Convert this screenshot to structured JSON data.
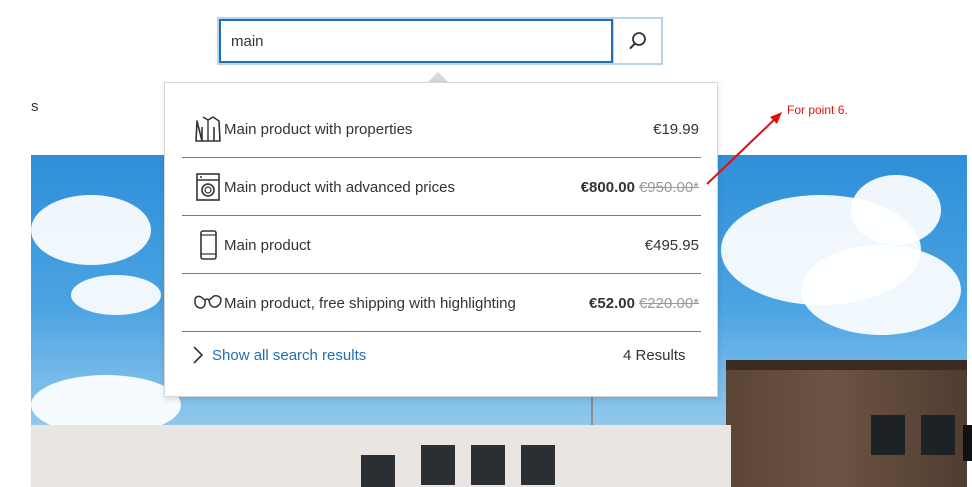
{
  "search": {
    "value": "main",
    "button_icon": "search-icon"
  },
  "page": {
    "left_label": "s"
  },
  "results": [
    {
      "icon": "jacket-icon",
      "name": "Main product with properties",
      "price": "€19.99",
      "old_price": ""
    },
    {
      "icon": "washing-machine-icon",
      "name": "Main product with advanced prices",
      "price": "€800.00",
      "old_price": "€950.00*"
    },
    {
      "icon": "smartphone-icon",
      "name": "Main product",
      "price": "€495.95",
      "old_price": ""
    },
    {
      "icon": "sunglasses-icon",
      "name": "Main product, free shipping with highlighting",
      "price": "€52.00",
      "old_price": "€220.00*"
    }
  ],
  "footer": {
    "show_all_label": "Show all search results",
    "results_count": "4 Results"
  },
  "annotation": {
    "text": "For point 6."
  },
  "colors": {
    "accent": "#1f6fb2",
    "annotation": "#e01010"
  }
}
